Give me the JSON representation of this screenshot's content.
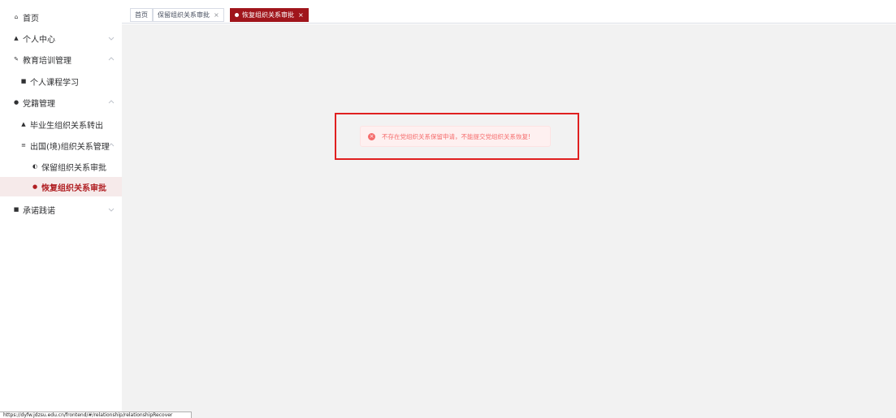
{
  "sidebar": {
    "items": [
      {
        "label": "首页",
        "icon": "home-icon",
        "glyph": "⌂"
      },
      {
        "label": "个人中心",
        "icon": "user-icon",
        "glyph": "▲"
      },
      {
        "label": "教育培训管理",
        "icon": "edit-icon",
        "glyph": "✎"
      },
      {
        "label": "个人课程学习",
        "icon": "book-icon",
        "glyph": "■"
      },
      {
        "label": "党籍管理",
        "icon": "badge-icon",
        "glyph": "●"
      },
      {
        "label": "毕业生组织关系转出",
        "icon": "graduate-icon",
        "glyph": "▲"
      },
      {
        "label": "出国(境)组织关系管理",
        "icon": "list-icon",
        "glyph": "≡"
      },
      {
        "label": "保留组织关系审批",
        "icon": "approve-icon",
        "glyph": "◐"
      },
      {
        "label": "恢复组织关系审批",
        "icon": "restore-icon",
        "glyph": "●"
      },
      {
        "label": "承诺践诺",
        "icon": "promise-icon",
        "glyph": "■"
      }
    ]
  },
  "tabs": {
    "home": "首页",
    "retain": "保留组织关系审批",
    "restore": "恢复组织关系审批",
    "close_glyph": "×"
  },
  "alert": {
    "message": "不存在党组织关系保留申请，不能提交党组织关系恢复!",
    "icon": "error-circle-icon",
    "icon_glyph": "×"
  },
  "statusbar": {
    "url": "https://dyfw.jdzsu.edu.cn/frontend/#/relationship/relationshipRecover"
  },
  "colors": {
    "accent": "#a0151b",
    "active_text": "#b01e22",
    "error": "#f56c6c",
    "main_bg": "#f2f2f2"
  }
}
